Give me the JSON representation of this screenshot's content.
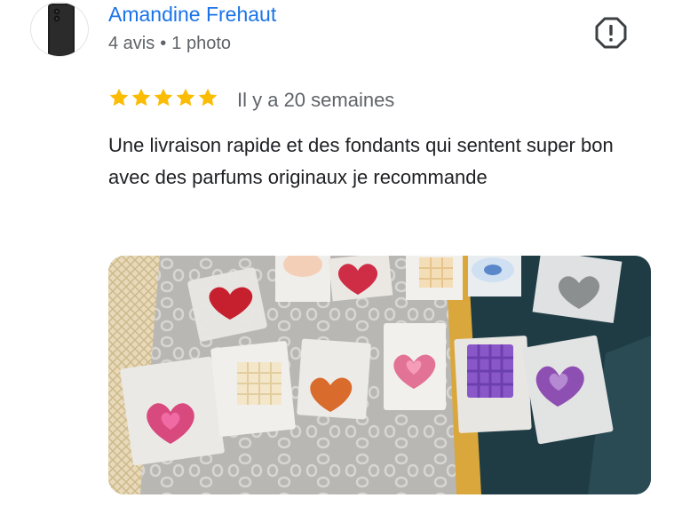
{
  "author": {
    "name": "Amandine Frehaut",
    "reviews_count": "4 avis",
    "separator": "•",
    "photos_count": "1 photo",
    "avatar_icon": "phone-avatar"
  },
  "report": {
    "icon": "report-flag-icon"
  },
  "rating": {
    "stars": 5,
    "max": 5,
    "color": "#fbbc04"
  },
  "date": "Il y a 20 semaines",
  "text": "Une livraison rapide et des fondants qui sentent super bon avec des parfums originaux je recommande",
  "photo": {
    "subject": "wax-melts-photo"
  },
  "colors": {
    "link": "#1a73e8",
    "meta": "#5f6368",
    "text": "#202124"
  }
}
